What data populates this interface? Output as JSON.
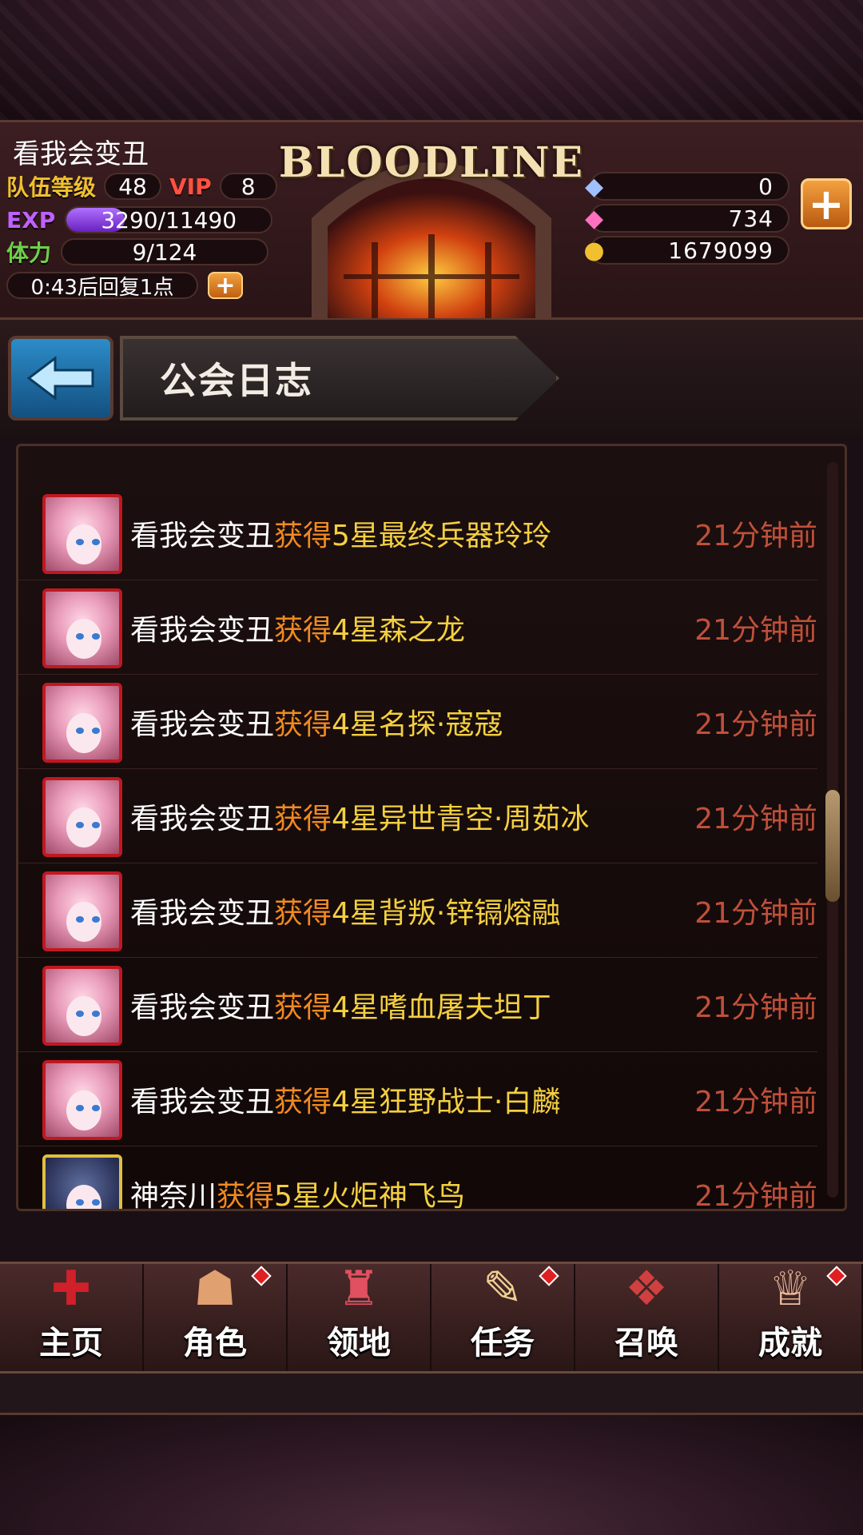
{
  "header": {
    "player_name": "看我会变丑",
    "team_level_label": "队伍等级",
    "team_level": "48",
    "vip_label": "VIP",
    "vip_level": "8",
    "exp_label": "EXP",
    "exp_text": "3290/11490",
    "exp_progress": 0.286,
    "stamina_label": "体力",
    "stamina_text": "9/124",
    "recover_text": "0:43后回复1点",
    "logo": "BLOODLINE",
    "currencies": {
      "crystal": "0",
      "gem": "734",
      "gold": "1679099"
    }
  },
  "title": "公会日志",
  "log": [
    {
      "who": "看我会变丑",
      "verb": "获得",
      "item": "5星最终兵器玲玲",
      "time": "21分钟前"
    },
    {
      "who": "看我会变丑",
      "verb": "获得",
      "item": "4星森之龙",
      "time": "21分钟前"
    },
    {
      "who": "看我会变丑",
      "verb": "获得",
      "item": "4星名探·寇寇",
      "time": "21分钟前"
    },
    {
      "who": "看我会变丑",
      "verb": "获得",
      "item": "4星异世青空·周茹冰",
      "time": "21分钟前"
    },
    {
      "who": "看我会变丑",
      "verb": "获得",
      "item": "4星背叛·锌镉熔融",
      "time": "21分钟前"
    },
    {
      "who": "看我会变丑",
      "verb": "获得",
      "item": "4星嗜血屠夫坦丁",
      "time": "21分钟前"
    },
    {
      "who": "看我会变丑",
      "verb": "获得",
      "item": "4星狂野战士·白麟",
      "time": "21分钟前"
    },
    {
      "who": "神奈川",
      "verb": "获得",
      "item": "5星火炬神飞鸟",
      "time": "21分钟前"
    }
  ],
  "nav": [
    {
      "label": "主页",
      "icon": "shield-icon",
      "badge": false
    },
    {
      "label": "角色",
      "icon": "character-icon",
      "badge": true
    },
    {
      "label": "领地",
      "icon": "castle-icon",
      "badge": false
    },
    {
      "label": "任务",
      "icon": "quest-book-icon",
      "badge": true
    },
    {
      "label": "召唤",
      "icon": "summon-cards-icon",
      "badge": false
    },
    {
      "label": "成就",
      "icon": "trophy-icon",
      "badge": true
    }
  ]
}
